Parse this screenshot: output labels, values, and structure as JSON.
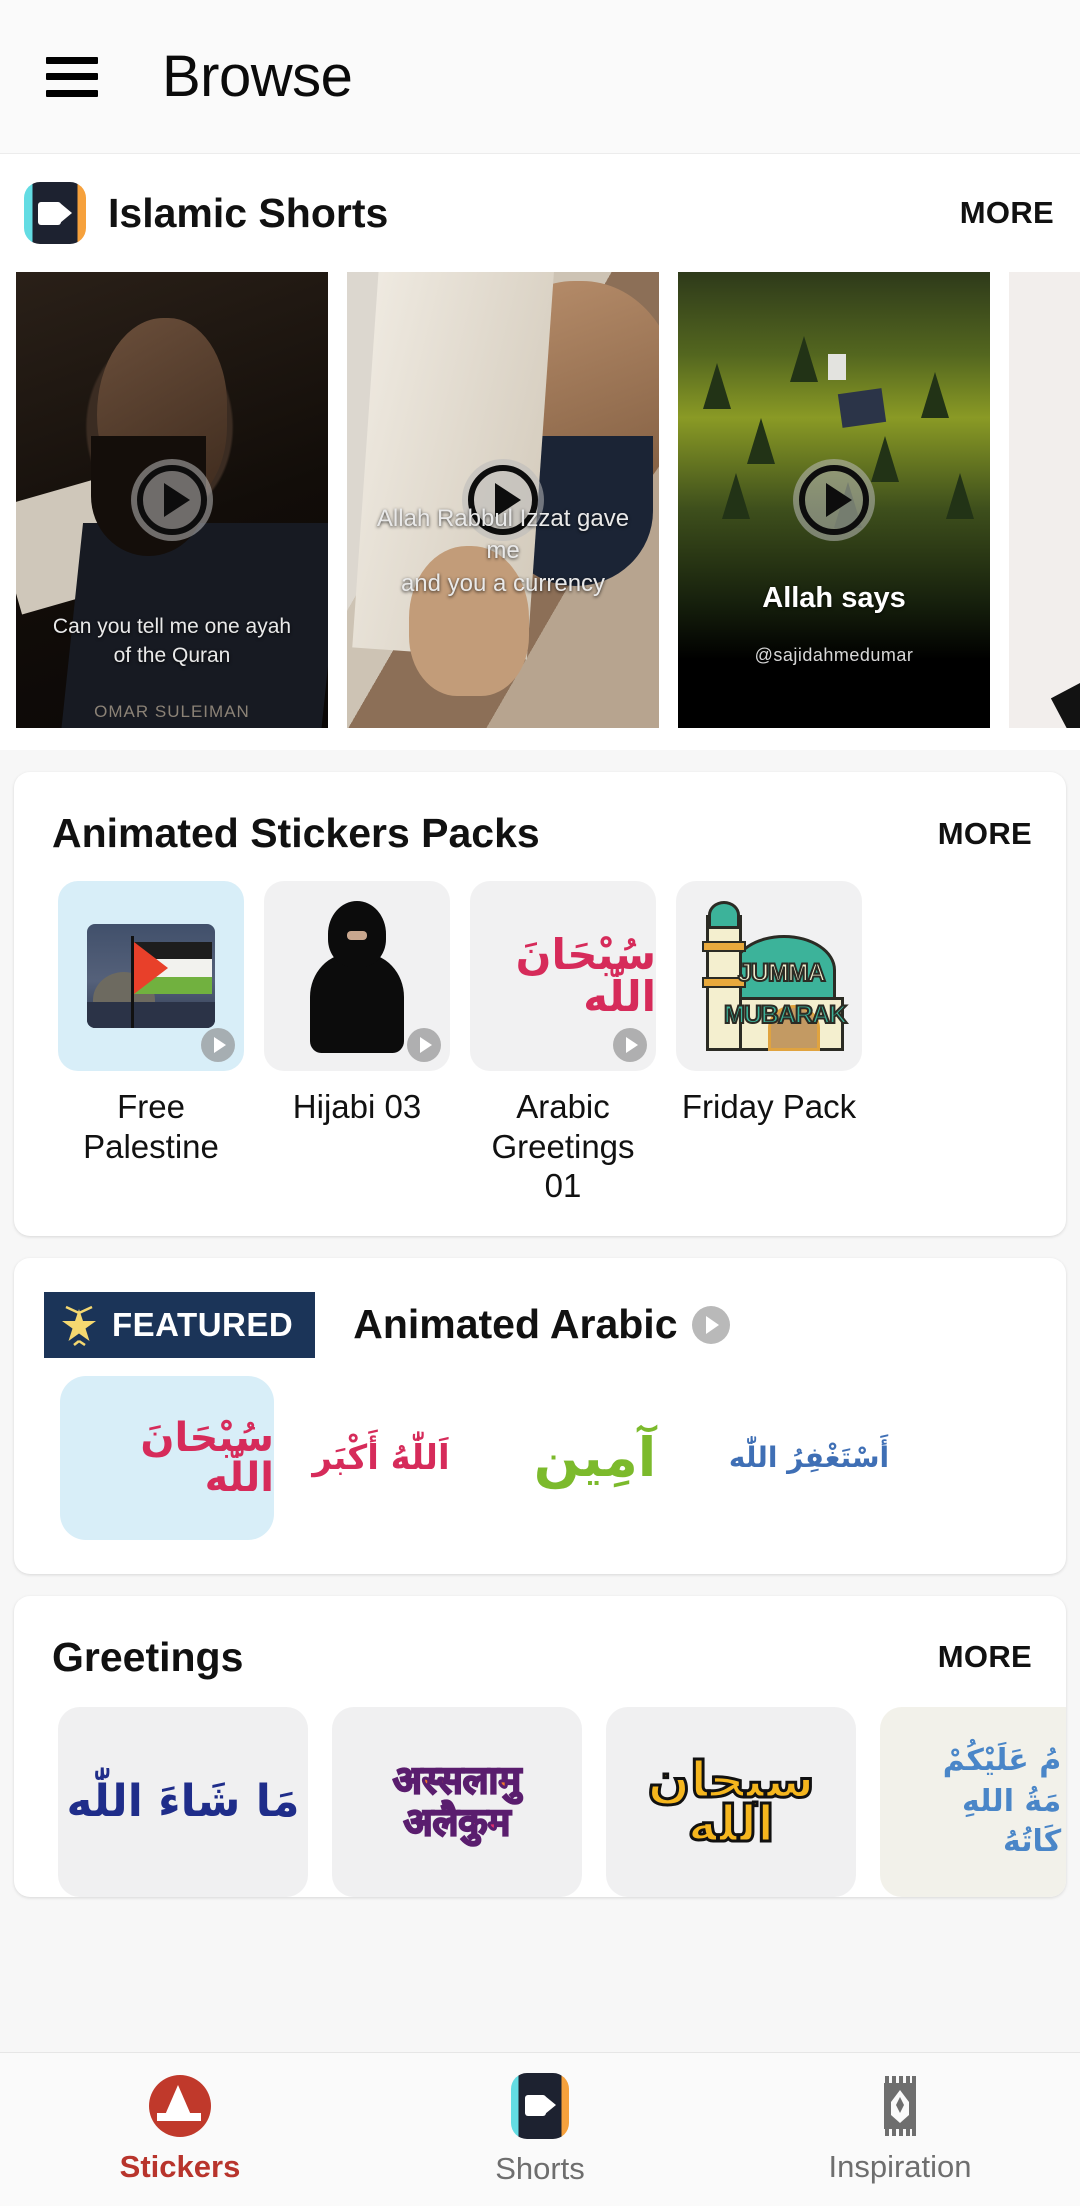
{
  "appbar": {
    "menu_icon": "hamburger-menu-icon",
    "title": "Browse"
  },
  "shorts_section": {
    "logo_icon": "video-camera-icon",
    "title": "Islamic Shorts",
    "more_label": "MORE",
    "videos": [
      {
        "caption": "Can you tell me one ayah\nof the Quran",
        "caption_line1": "Can you tell me one ayah",
        "caption_line2": "of the Quran",
        "signature": "OMAR SULEIMAN",
        "play_icon": "play-icon"
      },
      {
        "caption_line1": "Allah Rabbul Izzat gave me",
        "caption_line2": "and you a currency",
        "play_icon": "play-icon"
      },
      {
        "caption_line1": "Allah says",
        "handle": "@sajidahmedumar",
        "play_icon": "play-icon"
      },
      {
        "caption_line1": "",
        "play_icon": "play-icon"
      }
    ]
  },
  "stickers_section": {
    "title": "Animated Stickers Packs",
    "more_label": "MORE",
    "packs": [
      {
        "label": "Free Palestine",
        "tile": "blue",
        "art": "palestine-flag",
        "badge_icon": "play-icon"
      },
      {
        "label": "Hijabi 03",
        "tile": "plain",
        "art": "hijabi",
        "badge_icon": "play-icon"
      },
      {
        "label": "Arabic Greetings 01",
        "tile": "plain",
        "art": "subhanallah-arabic",
        "arabic": "سُبْحَانَ اللّٰه",
        "color": "#d62b5a",
        "badge_icon": "play-icon"
      },
      {
        "label": "Friday Pack",
        "tile": "plain",
        "art": "jumma-mubarak-mosque",
        "word1": "JUMMA",
        "word2": "MUBARAK",
        "badge_icon": "play-icon"
      }
    ]
  },
  "featured_section": {
    "badge_label": "FEATURED",
    "badge_icon": "star-icon",
    "title": "Animated Arabic",
    "play_icon": "play-icon",
    "items": [
      {
        "arabic": "سُبْحَانَ اللّٰه",
        "color": "#d62b5a",
        "selected": true
      },
      {
        "arabic": "اَللّٰهُ أَكْبَر",
        "color": "#d62b5a",
        "selected": false
      },
      {
        "arabic": "آمِين",
        "color": "#7cba2c",
        "selected": false
      },
      {
        "arabic": "أَسْتَغْفِرُ اللّٰه",
        "color": "#3f6fb5",
        "selected": false
      }
    ]
  },
  "greetings_section": {
    "title": "Greetings",
    "more_label": "MORE",
    "items": [
      {
        "arabic": "مَا شَاءَ اللّٰه",
        "color": "#1f2d8a",
        "tile": "plain"
      },
      {
        "hindi_line1": "अस्सलामु",
        "hindi_line2": "अलैकुम",
        "color": "#f0772a",
        "color2": "#e0306e",
        "tile": "plain"
      },
      {
        "arabic_line1": "سبحان",
        "arabic_line2": "الله",
        "color": "#f5b61e",
        "tile": "plain"
      },
      {
        "arabic_line1": "مُ عَلَيْكُمْ",
        "arabic_line2": "مَةُ اللهِ",
        "arabic_line3": "كَاتُهُ",
        "color": "#4a86c8",
        "tile": "cream"
      }
    ]
  },
  "tabbar": {
    "tabs": [
      {
        "label": "Stickers",
        "icon": "sticker-dome-icon",
        "active": true
      },
      {
        "label": "Shorts",
        "icon": "video-camera-icon",
        "active": false
      },
      {
        "label": "Inspiration",
        "icon": "prayer-rug-icon",
        "active": false
      }
    ]
  },
  "colors": {
    "accent_red": "#b8342c",
    "featured_navy": "#1b3458",
    "tile_blue": "#d8eef8",
    "page_bg": "#f7f7f7"
  }
}
